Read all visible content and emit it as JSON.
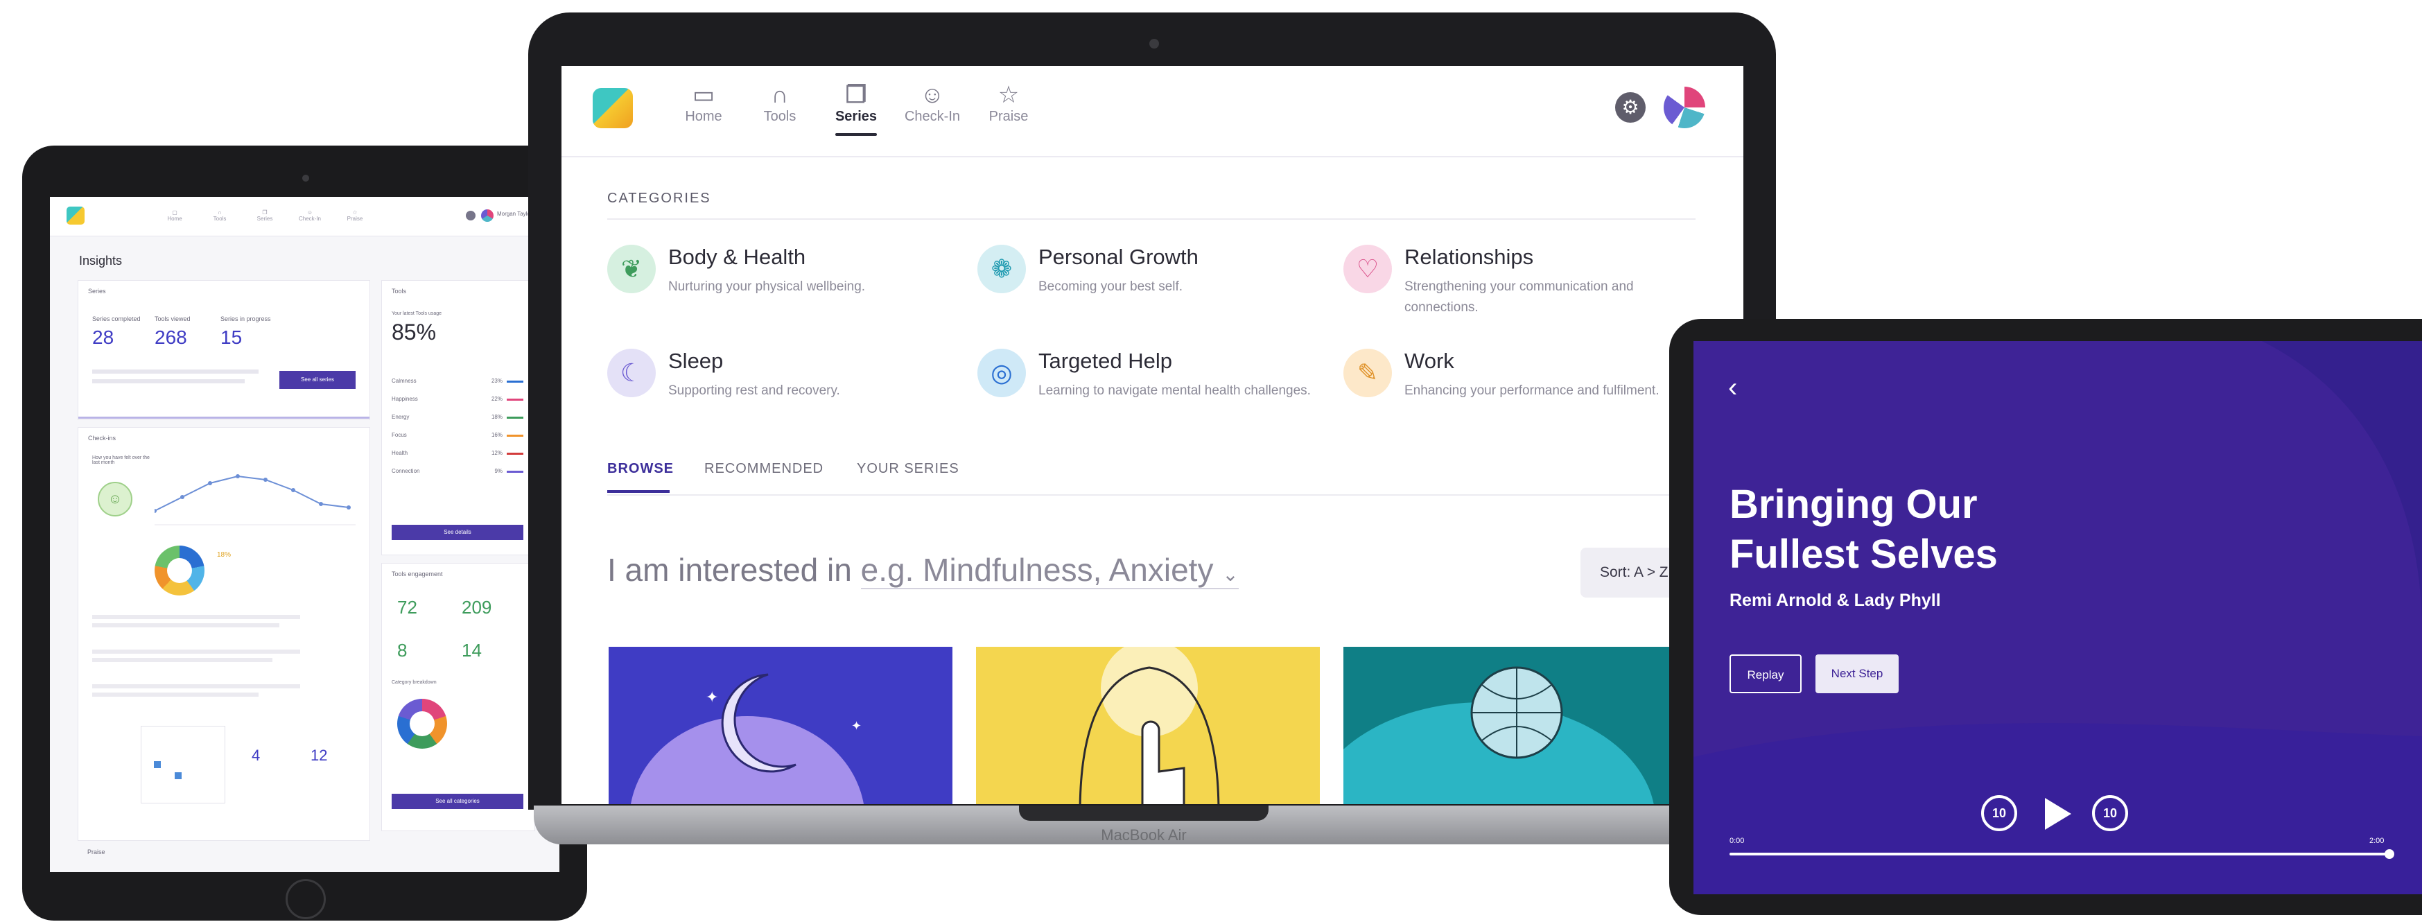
{
  "laptop": {
    "brand": "MacBook Air",
    "nav": {
      "items": [
        {
          "label": "Home",
          "icon": "chat-bubble-icon"
        },
        {
          "label": "Tools",
          "icon": "headphones-icon"
        },
        {
          "label": "Series",
          "icon": "stack-icon"
        },
        {
          "label": "Check-In",
          "icon": "smiley-icon"
        },
        {
          "label": "Praise",
          "icon": "star-icon"
        }
      ],
      "active": "Series"
    },
    "categories_title": "CATEGORIES",
    "categories": [
      {
        "title": "Body & Health",
        "desc": "Nurturing your physical wellbeing.",
        "icon": "body-icon",
        "color": "#d6f0e0"
      },
      {
        "title": "Personal Growth",
        "desc": "Becoming your best self.",
        "icon": "growth-icon",
        "color": "#d4eef3"
      },
      {
        "title": "Relationships",
        "desc": "Strengthening your communication and connections.",
        "icon": "hearts-icon",
        "color": "#f9d7e6"
      },
      {
        "title": "Sleep",
        "desc": "Supporting rest and recovery.",
        "icon": "moon-icon",
        "color": "#e4e1f7"
      },
      {
        "title": "Targeted Help",
        "desc": "Learning to navigate mental health challenges.",
        "icon": "target-icon",
        "color": "#cfe9f7"
      },
      {
        "title": "Work",
        "desc": "Enhancing your performance and fulfilment.",
        "icon": "briefcase-icon",
        "color": "#fde8c9"
      }
    ],
    "tabs": [
      "BROWSE",
      "RECOMMENDED",
      "YOUR SERIES"
    ],
    "interest_prefix": "I am interested in",
    "interest_placeholder": "e.g. Mindfulness, Anxiety",
    "sort_label": "Sort: A > Z"
  },
  "left_tablet": {
    "page_title": "Insights",
    "user": "Morgan Taylor",
    "series": {
      "section": "Series",
      "stats": [
        {
          "label": "Series completed",
          "value": "28"
        },
        {
          "label": "Tools viewed",
          "value": "268"
        },
        {
          "label": "Series in progress",
          "value": "15"
        }
      ],
      "button": "See all series"
    },
    "checkins": {
      "section": "Check-ins"
    },
    "chart_label": "How you have felt over the last month",
    "mood_pct": "18%",
    "tools": {
      "section": "Tools",
      "subtitle": "Your latest Tools usage",
      "big": "85%",
      "rows": [
        "Calmness",
        "Happiness",
        "Energy",
        "Focus",
        "Health",
        "Connection"
      ],
      "pcts": [
        "23%",
        "22%",
        "18%",
        "16%",
        "12%",
        "9%"
      ],
      "button": "See details"
    },
    "engagement": {
      "section": "Tools engagement",
      "stats": [
        "72",
        "209",
        "8",
        "14"
      ],
      "label": "Category breakdown",
      "button": "See all categories"
    },
    "calendar_stats": [
      "4",
      "12"
    ],
    "praise_section": "Praise"
  },
  "right_tablet": {
    "title_line1": "Bringing Our",
    "title_line2": "Fullest Selves",
    "author": "Remi Arnold & Lady Phyll",
    "replay": "Replay",
    "next": "Next Step",
    "skip_back": "10",
    "skip_fwd": "10",
    "time_start": "0:00",
    "time_end": "2:00",
    "progress": 1.0
  }
}
